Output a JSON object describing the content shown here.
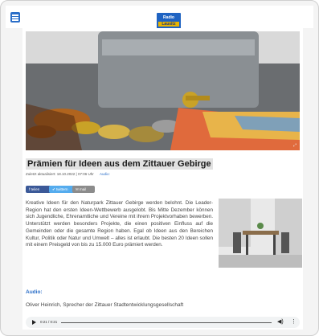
{
  "header": {
    "logo_line1": "Radio",
    "logo_line2": "Lausitz",
    "colors": {
      "brand": "#1f63c2",
      "accent": "#e8b400"
    }
  },
  "article": {
    "headline": "Prämien für Ideen aus dem Zittauer Gebirge",
    "updated": "Zuletzt aktualisiert: 18.10.2022 | 07:06 Uhr",
    "audio_meta_label": "Audio:",
    "share": {
      "facebook": "teilen",
      "twitter": "twittern",
      "mail": "mail"
    },
    "body": "Kreative Ideen für den Naturpark Zittauer Gebirge werden belohnt. Die Leader-Region hat den ersten Ideen-Wettbewerb ausgelobt. Bis Mitte Dezember können sich Jugendliche, Ehrenamtliche und Vereine mit ihrem Projektvorhaben bewerben. Unterstützt werden besonders Projekte, die einen positiven Einfluss auf die Gemeinden oder die gesamte Region haben. Egal ob Ideen aus den Bereichen Kultur, Politik oder Natur und Umwelt – alles ist erlaubt. Die besten 20 Ideen sollen mit einem Preisgeld von bis zu 15.000 Euro prämiert werden.",
    "hero_icon": "cashbox-with-money-photo",
    "side_icon": "outdoor-furniture-photo"
  },
  "audio": {
    "label": "Audio:",
    "description": "Oliver Heinrich, Sprecher der Zittauer Stadtentwicklungsgesellschaft",
    "time": "0:21 / 0:21",
    "volume_icon": "volume-icon",
    "more_icon": "more-vertical-icon"
  }
}
